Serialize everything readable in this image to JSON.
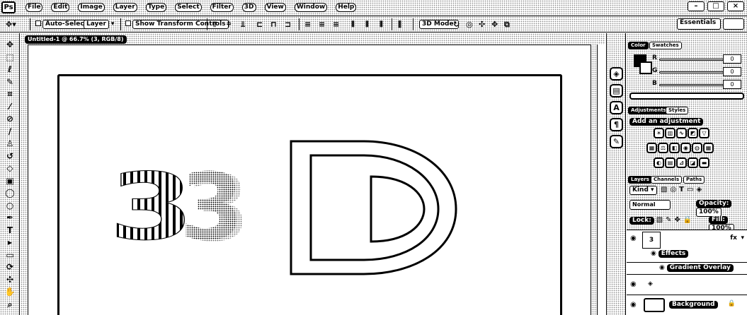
{
  "app": {
    "logo": "Ps"
  },
  "menubar": {
    "items": [
      "File",
      "Edit",
      "Image",
      "Layer",
      "Type",
      "Select",
      "Filter",
      "3D",
      "View",
      "Window",
      "Help"
    ],
    "window_controls": {
      "minimize": "–",
      "maximize": "□",
      "close": "×"
    }
  },
  "options_bar": {
    "auto_select_label": "Auto-Select",
    "auto_select_target": "Layer",
    "show_transform_label": "Show Transform Controls",
    "mode_3d_label": "3D Mode:",
    "align_icons": [
      "align-top-icon",
      "align-vcenter-icon",
      "align-bottom-icon",
      "align-left-icon",
      "align-hcenter-icon",
      "align-right-icon"
    ],
    "distribute_icons": [
      "dist-top-icon",
      "dist-vcenter-icon",
      "dist-bottom-icon",
      "dist-left-icon",
      "dist-hcenter-icon",
      "dist-right-icon"
    ],
    "workspace_label": "Essentials"
  },
  "document": {
    "tab_title": "Untitled-1 @ 66.7% (3, RGB/8)",
    "art_text": {
      "left": "3",
      "right": "D"
    },
    "colors": {
      "background": "#ffffff",
      "stroke": "#000000"
    }
  },
  "tools": [
    {
      "name": "move-tool-icon",
      "glyph": "✥"
    },
    {
      "name": "marquee-tool-icon",
      "glyph": "⬚"
    },
    {
      "name": "lasso-tool-icon",
      "glyph": "ℓ"
    },
    {
      "name": "quick-select-tool-icon",
      "glyph": "✎"
    },
    {
      "name": "crop-tool-icon",
      "glyph": "⌗"
    },
    {
      "name": "eyedropper-tool-icon",
      "glyph": "⁄"
    },
    {
      "name": "healing-brush-tool-icon",
      "glyph": "⊘"
    },
    {
      "name": "brush-tool-icon",
      "glyph": "∕"
    },
    {
      "name": "clone-stamp-tool-icon",
      "glyph": "♙"
    },
    {
      "name": "history-brush-tool-icon",
      "glyph": "↺"
    },
    {
      "name": "eraser-tool-icon",
      "glyph": "◇"
    },
    {
      "name": "gradient-tool-icon",
      "glyph": "▣"
    },
    {
      "name": "blur-tool-icon",
      "glyph": "◯"
    },
    {
      "name": "dodge-tool-icon",
      "glyph": "○"
    },
    {
      "name": "pen-tool-icon",
      "glyph": "✒"
    },
    {
      "name": "type-tool-icon",
      "glyph": "T"
    },
    {
      "name": "path-select-tool-icon",
      "glyph": "▸"
    },
    {
      "name": "shape-tool-icon",
      "glyph": "▭"
    },
    {
      "name": "3d-rotate-tool-icon",
      "glyph": "⟳"
    },
    {
      "name": "3d-orbit-tool-icon",
      "glyph": "✣"
    },
    {
      "name": "hand-tool-icon",
      "glyph": "✋"
    },
    {
      "name": "zoom-tool-icon",
      "glyph": "⌕"
    }
  ],
  "side_icons": [
    {
      "name": "3d-panel-icon",
      "glyph": "◈"
    },
    {
      "name": "history-panel-icon",
      "glyph": "▤"
    },
    {
      "name": "character-panel-icon",
      "glyph": "A"
    },
    {
      "name": "paragraph-panel-icon",
      "glyph": "¶"
    },
    {
      "name": "brush-panel-icon",
      "glyph": "✎"
    }
  ],
  "color_panel": {
    "tabs": [
      "Color",
      "Swatches"
    ],
    "channels": [
      {
        "label": "R",
        "value": "0"
      },
      {
        "label": "G",
        "value": "0"
      },
      {
        "label": "B",
        "value": "0"
      }
    ]
  },
  "adjustments_panel": {
    "tabs": [
      "Adjustments",
      "Styles"
    ],
    "add_label": "Add an adjustment",
    "row1": [
      "brightness-icon",
      "levels-icon",
      "curves-icon",
      "exposure-icon",
      "vibrance-icon"
    ],
    "row2": [
      "hue-sat-icon",
      "color-balance-icon",
      "bw-icon",
      "photo-filter-icon",
      "channel-mixer-icon",
      "color-lookup-icon"
    ],
    "row3": [
      "invert-icon",
      "posterize-icon",
      "threshold-icon",
      "selective-color-icon",
      "gradient-map-icon"
    ]
  },
  "layers_panel": {
    "tabs": [
      "Layers",
      "Channels",
      "Paths"
    ],
    "kind_label": "Kind",
    "blend_mode": "Normal",
    "opacity_label": "Opacity:",
    "opacity_value": "100%",
    "lock_label": "Lock:",
    "fill_label": "Fill:",
    "fill_value": "100%",
    "layers": [
      {
        "name": "3",
        "type": "3d",
        "effects_label": "fx"
      },
      {
        "name": "Effects",
        "type": "effect-group"
      },
      {
        "name": "Gradient Overlay",
        "type": "effect"
      },
      {
        "name": "",
        "type": "3d-sub"
      },
      {
        "name": "Background",
        "type": "background"
      }
    ]
  }
}
